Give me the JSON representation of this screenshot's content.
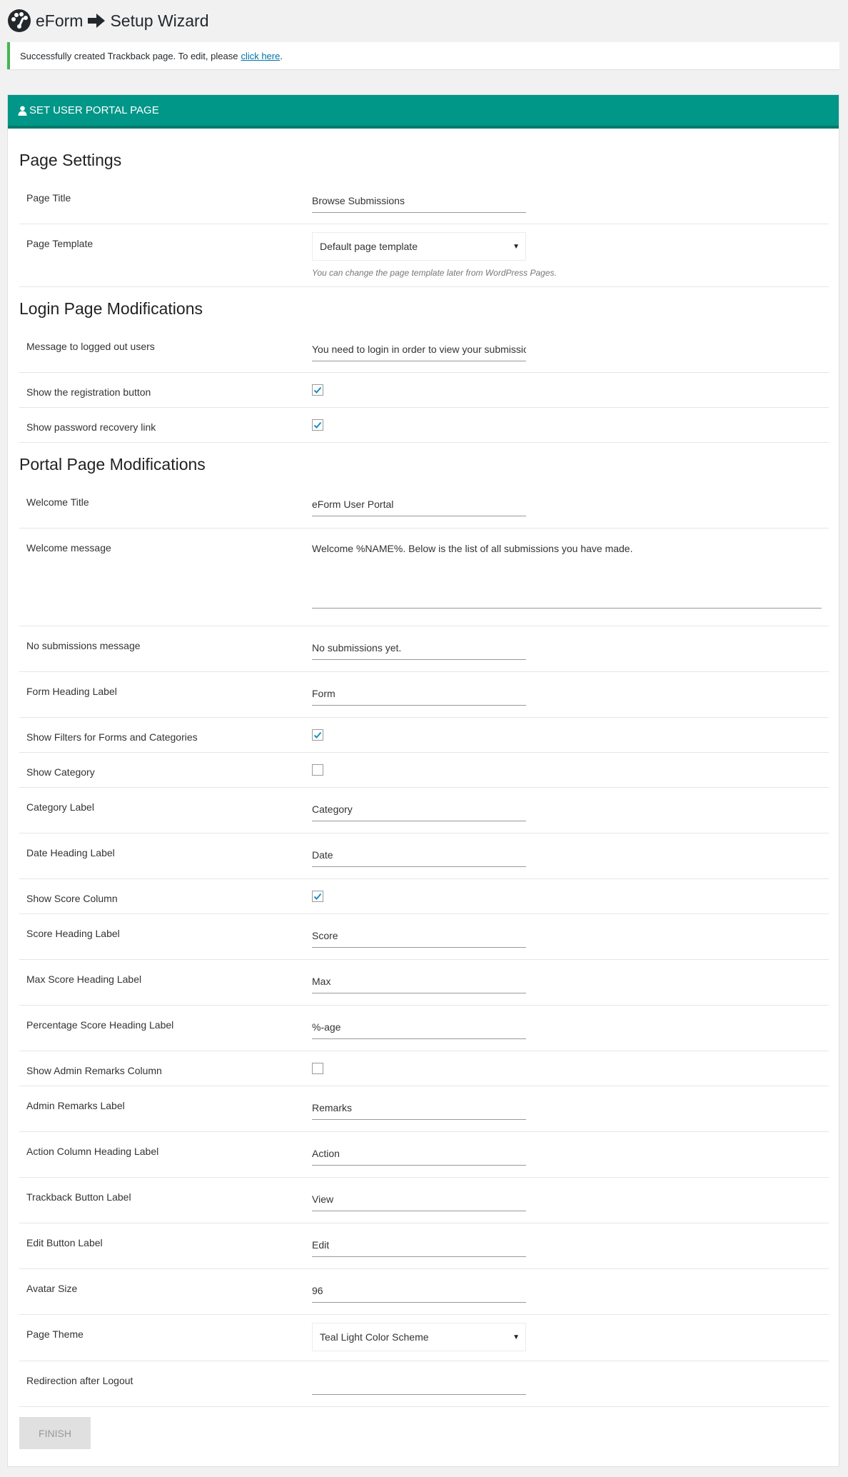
{
  "header": {
    "app_name": "eForm",
    "page_title": "Setup Wizard"
  },
  "notice": {
    "text": "Successfully created Trackback page. To edit, please",
    "link_text": "click here",
    "suffix": "."
  },
  "panel": {
    "title": "SET USER PORTAL PAGE",
    "header_color": "#009688"
  },
  "sections": {
    "page_settings": "Page Settings",
    "login": "Login Page Modifications",
    "portal": "Portal Page Modifications"
  },
  "fields": {
    "page_title": {
      "label": "Page Title",
      "value": "Browse Submissions"
    },
    "page_template": {
      "label": "Page Template",
      "value": "Default page template",
      "help": "You can change the page template later from WordPress Pages."
    },
    "logged_out_message": {
      "label": "Message to logged out users",
      "value": "You need to login in order to view your submissio"
    },
    "show_registration": {
      "label": "Show the registration button",
      "checked": true
    },
    "show_password_recovery": {
      "label": "Show password recovery link",
      "checked": true
    },
    "welcome_title": {
      "label": "Welcome Title",
      "value": "eForm User Portal"
    },
    "welcome_message": {
      "label": "Welcome message",
      "value": "Welcome %NAME%. Below is the list of all submissions you have made."
    },
    "no_submissions": {
      "label": "No submissions message",
      "value": "No submissions yet."
    },
    "form_heading": {
      "label": "Form Heading Label",
      "value": "Form"
    },
    "show_filters": {
      "label": "Show Filters for Forms and Categories",
      "checked": true
    },
    "show_category": {
      "label": "Show Category",
      "checked": false
    },
    "category_label": {
      "label": "Category Label",
      "value": "Category"
    },
    "date_heading": {
      "label": "Date Heading Label",
      "value": "Date"
    },
    "show_score": {
      "label": "Show Score Column",
      "checked": true
    },
    "score_heading": {
      "label": "Score Heading Label",
      "value": "Score"
    },
    "max_score_heading": {
      "label": "Max Score Heading Label",
      "value": "Max"
    },
    "percentage_heading": {
      "label": "Percentage Score Heading Label",
      "value": "%-age"
    },
    "show_admin_remarks": {
      "label": "Show Admin Remarks Column",
      "checked": false
    },
    "admin_remarks_label": {
      "label": "Admin Remarks Label",
      "value": "Remarks"
    },
    "action_heading": {
      "label": "Action Column Heading Label",
      "value": "Action"
    },
    "trackback_button": {
      "label": "Trackback Button Label",
      "value": "View"
    },
    "edit_button": {
      "label": "Edit Button Label",
      "value": "Edit"
    },
    "avatar_size": {
      "label": "Avatar Size",
      "value": "96"
    },
    "page_theme": {
      "label": "Page Theme",
      "value": "Teal Light Color Scheme"
    },
    "redirect_logout": {
      "label": "Redirection after Logout",
      "value": ""
    }
  },
  "finish_label": "FINISH"
}
